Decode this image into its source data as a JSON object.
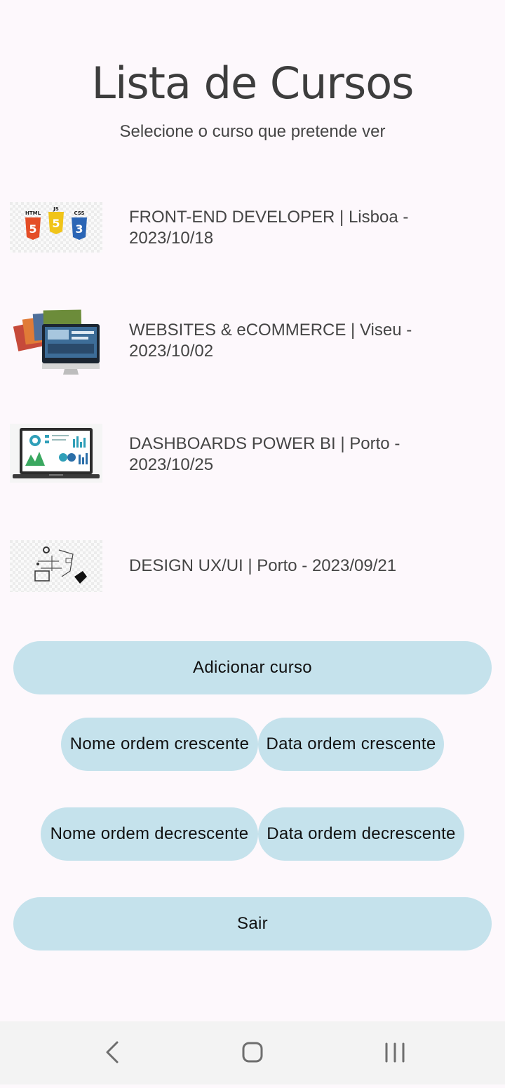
{
  "header": {
    "title": "Lista de Cursos",
    "subtitle": "Selecione o curso que pretende ver"
  },
  "courses": [
    {
      "label": "FRONT-END DEVELOPER | Lisboa - 2023/10/18",
      "icon": "html-js-css-logos-image"
    },
    {
      "label": "WEBSITES & eCOMMERCE | Viseu - 2023/10/02",
      "icon": "websites-monitor-image"
    },
    {
      "label": "DASHBOARDS POWER BI | Porto - 2023/10/25",
      "icon": "dashboard-laptop-image"
    },
    {
      "label": "DESIGN UX/UI | Porto - 2023/09/21",
      "icon": "design-sketch-image"
    }
  ],
  "buttons": {
    "add": "Adicionar curso",
    "name_asc": "Nome ordem crescente",
    "date_asc": "Data ordem crescente",
    "name_desc": "Nome ordem decrescente",
    "date_desc": "Data ordem decrescente",
    "exit": "Sair"
  },
  "colors": {
    "background": "#fdf8fc",
    "button": "#c5e2ec",
    "text": "#454545",
    "navbar": "#f3f3f3"
  },
  "navbar": {
    "icons": [
      "back-icon",
      "home-icon",
      "recents-icon"
    ]
  }
}
